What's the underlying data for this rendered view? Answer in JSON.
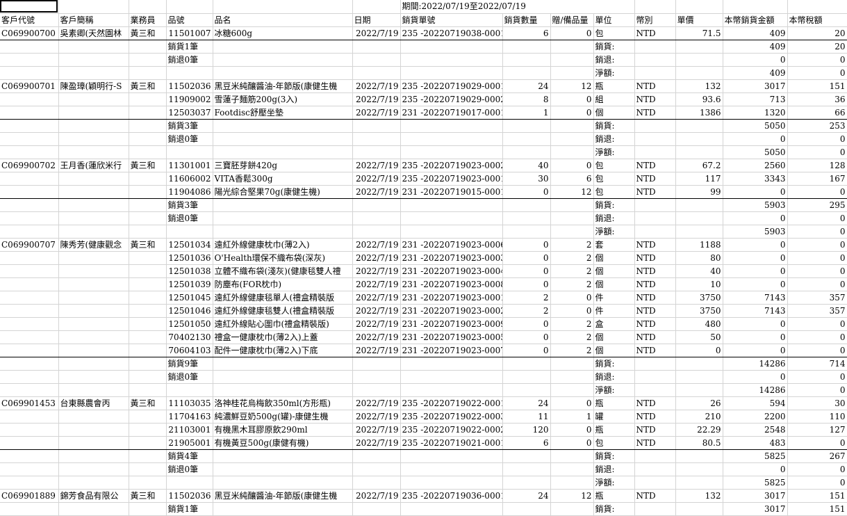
{
  "period_label": "期間:2022/07/19至2022/07/19",
  "header": [
    "客戶代號",
    "客戶簡稱",
    "業務員",
    "品號",
    "品名",
    "日期",
    "銷貨單號",
    "銷貨數量",
    "贈/備品量",
    "單位",
    "幣別",
    "單價",
    "本幣銷貨金額",
    "本幣稅額"
  ],
  "rows": [
    [
      "C069900700",
      "吳素卿(天然園林",
      "黃三和",
      "11501007",
      "冰糖600g",
      "2022/7/19",
      "235 -20220719038-0001",
      "6",
      "0",
      "包",
      "NTD",
      "71.5",
      "409",
      "20"
    ],
    [
      "",
      "",
      "",
      "銷貨1筆",
      "",
      "",
      "",
      "",
      "",
      "銷貨:",
      "",
      "",
      "409",
      "20"
    ],
    [
      "",
      "",
      "",
      "銷退0筆",
      "",
      "",
      "",
      "",
      "",
      "銷退:",
      "",
      "",
      "0",
      "0"
    ],
    [
      "",
      "",
      "",
      "",
      "",
      "",
      "",
      "",
      "",
      "淨額:",
      "",
      "",
      "409",
      "0"
    ],
    [
      "C069900701",
      "陳盈璋(穎明行-S",
      "黃三和",
      "11502036",
      "黑豆米純釀醬油-年節版(康健生機",
      "2022/7/19",
      "235 -20220719029-0001",
      "24",
      "12",
      "瓶",
      "NTD",
      "132",
      "3017",
      "151"
    ],
    [
      "",
      "",
      "",
      "11909002",
      "雪蓮子麵筋200g(3入)",
      "2022/7/19",
      "235 -20220719029-0002",
      "8",
      "0",
      "組",
      "NTD",
      "93.6",
      "713",
      "36"
    ],
    [
      "",
      "",
      "",
      "12503037",
      "Footdisc舒壓坐墊",
      "2022/7/19",
      "231 -20220719017-0001",
      "1",
      "0",
      "個",
      "NTD",
      "1386",
      "1320",
      "66"
    ],
    [
      "",
      "",
      "",
      "銷貨3筆",
      "",
      "",
      "",
      "",
      "",
      "銷貨:",
      "",
      "",
      "5050",
      "253"
    ],
    [
      "",
      "",
      "",
      "銷退0筆",
      "",
      "",
      "",
      "",
      "",
      "銷退:",
      "",
      "",
      "0",
      "0"
    ],
    [
      "",
      "",
      "",
      "",
      "",
      "",
      "",
      "",
      "",
      "淨額:",
      "",
      "",
      "5050",
      "0"
    ],
    [
      "C069900702",
      "王月香(蓮欣米行",
      "黃三和",
      "11301001",
      "三寶胚芽餅420g",
      "2022/7/19",
      "235 -20220719023-0002",
      "40",
      "0",
      "包",
      "NTD",
      "67.2",
      "2560",
      "128"
    ],
    [
      "",
      "",
      "",
      "11606002",
      "VITA香鬆300g",
      "2022/7/19",
      "235 -20220719023-0001",
      "30",
      "6",
      "包",
      "NTD",
      "117",
      "3343",
      "167"
    ],
    [
      "",
      "",
      "",
      "11904086",
      "陽光綜合堅果70g(康健生機)",
      "2022/7/19",
      "231 -20220719015-0001",
      "0",
      "12",
      "包",
      "NTD",
      "99",
      "0",
      "0"
    ],
    [
      "",
      "",
      "",
      "銷貨3筆",
      "",
      "",
      "",
      "",
      "",
      "銷貨:",
      "",
      "",
      "5903",
      "295"
    ],
    [
      "",
      "",
      "",
      "銷退0筆",
      "",
      "",
      "",
      "",
      "",
      "銷退:",
      "",
      "",
      "0",
      "0"
    ],
    [
      "",
      "",
      "",
      "",
      "",
      "",
      "",
      "",
      "",
      "淨額:",
      "",
      "",
      "5903",
      "0"
    ],
    [
      "C069900707",
      "陳秀芳(健康觀念",
      "黃三和",
      "12501034",
      "遠紅外線健康枕巾(薄2入)",
      "2022/7/19",
      "231 -20220719023-0006",
      "0",
      "2",
      "套",
      "NTD",
      "1188",
      "0",
      "0"
    ],
    [
      "",
      "",
      "",
      "12501036",
      "O'Health環保不織布袋(深灰)",
      "2022/7/19",
      "231 -20220719023-0003",
      "0",
      "2",
      "個",
      "NTD",
      "80",
      "0",
      "0"
    ],
    [
      "",
      "",
      "",
      "12501038",
      "立體不織布袋(淺灰)(健康毯雙人禮",
      "2022/7/19",
      "231 -20220719023-0004",
      "0",
      "2",
      "個",
      "NTD",
      "40",
      "0",
      "0"
    ],
    [
      "",
      "",
      "",
      "12501039",
      "防塵布(FOR枕巾)",
      "2022/7/19",
      "231 -20220719023-0008",
      "0",
      "2",
      "個",
      "NTD",
      "10",
      "0",
      "0"
    ],
    [
      "",
      "",
      "",
      "12501045",
      "遠紅外線健康毯單人(禮盒精裝版",
      "2022/7/19",
      "231 -20220719023-0001",
      "2",
      "0",
      "件",
      "NTD",
      "3750",
      "7143",
      "357"
    ],
    [
      "",
      "",
      "",
      "12501046",
      "遠紅外線健康毯雙人(禮盒精裝版",
      "2022/7/19",
      "231 -20220719023-0002",
      "2",
      "0",
      "件",
      "NTD",
      "3750",
      "7143",
      "357"
    ],
    [
      "",
      "",
      "",
      "12501050",
      "遠紅外線貼心圍巾(禮盒精裝版)",
      "2022/7/19",
      "231 -20220719023-0009",
      "0",
      "2",
      "盒",
      "NTD",
      "480",
      "0",
      "0"
    ],
    [
      "",
      "",
      "",
      "70402130",
      "禮盒一健康枕巾(薄2入)上蓋",
      "2022/7/19",
      "231 -20220719023-0005",
      "0",
      "2",
      "個",
      "NTD",
      "50",
      "0",
      "0"
    ],
    [
      "",
      "",
      "",
      "70604103",
      "配件一健康枕巾(薄2入)下底",
      "2022/7/19",
      "231 -20220719023-0007",
      "0",
      "2",
      "個",
      "NTD",
      "0",
      "0",
      "0"
    ],
    [
      "",
      "",
      "",
      "銷貨9筆",
      "",
      "",
      "",
      "",
      "",
      "銷貨:",
      "",
      "",
      "14286",
      "714"
    ],
    [
      "",
      "",
      "",
      "銷退0筆",
      "",
      "",
      "",
      "",
      "",
      "銷退:",
      "",
      "",
      "0",
      "0"
    ],
    [
      "",
      "",
      "",
      "",
      "",
      "",
      "",
      "",
      "",
      "淨額:",
      "",
      "",
      "14286",
      "0"
    ],
    [
      "C069901453",
      "台東縣農會丙",
      "黃三和",
      "11103035",
      "洛神桂花烏梅飲350ml(方形瓶)",
      "2022/7/19",
      "235 -20220719022-0001",
      "24",
      "0",
      "瓶",
      "NTD",
      "26",
      "594",
      "30"
    ],
    [
      "",
      "",
      "",
      "11704163",
      "純濃鮮豆奶500g(罐)-康健生機",
      "2022/7/19",
      "235 -20220719022-0003",
      "11",
      "1",
      "罐",
      "NTD",
      "210",
      "2200",
      "110"
    ],
    [
      "",
      "",
      "",
      "21103001",
      "有機黑木耳膠原飲290ml",
      "2022/7/19",
      "235 -20220719022-0002",
      "120",
      "0",
      "瓶",
      "NTD",
      "22.29",
      "2548",
      "127"
    ],
    [
      "",
      "",
      "",
      "21905001",
      "有機黃豆500g(康健有機)",
      "2022/7/19",
      "235 -20220719021-0001",
      "6",
      "0",
      "包",
      "NTD",
      "80.5",
      "483",
      "0"
    ],
    [
      "",
      "",
      "",
      "銷貨4筆",
      "",
      "",
      "",
      "",
      "",
      "銷貨:",
      "",
      "",
      "5825",
      "267"
    ],
    [
      "",
      "",
      "",
      "銷退0筆",
      "",
      "",
      "",
      "",
      "",
      "銷退:",
      "",
      "",
      "0",
      "0"
    ],
    [
      "",
      "",
      "",
      "",
      "",
      "",
      "",
      "",
      "",
      "淨額:",
      "",
      "",
      "5825",
      "0"
    ],
    [
      "C069901889",
      "錦芳食品有限公",
      "黃三和",
      "11502036",
      "黑豆米純釀醬油-年節版(康健生機",
      "2022/7/19",
      "235 -20220719036-0001",
      "24",
      "12",
      "瓶",
      "NTD",
      "132",
      "3017",
      "151"
    ],
    [
      "",
      "",
      "",
      "銷貨1筆",
      "",
      "",
      "",
      "",
      "",
      "銷貨:",
      "",
      "",
      "3017",
      "151"
    ]
  ]
}
